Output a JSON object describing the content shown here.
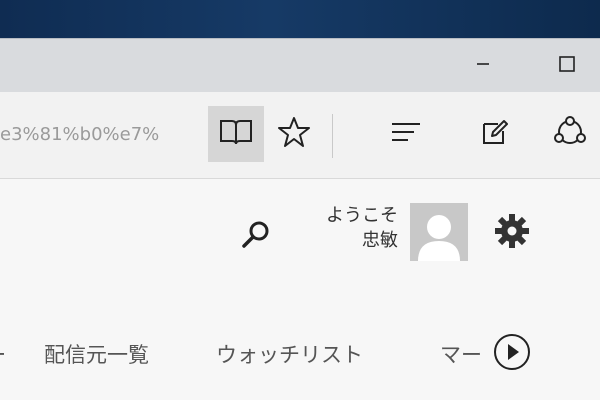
{
  "window": {
    "minimize_icon": "minimize-icon",
    "maximize_icon": "maximize-icon"
  },
  "toolbar": {
    "url_text": "e3%81%b0%e7%",
    "icons": [
      "reading-view-icon",
      "favorite-star-icon",
      "hub-icon",
      "web-note-icon",
      "share-icon"
    ]
  },
  "header": {
    "welcome_line1": "ようこそ",
    "welcome_line2": "忠敏",
    "icons": [
      "search-icon",
      "avatar",
      "settings-gear-icon"
    ]
  },
  "nav": {
    "partial_left": "ー",
    "items": [
      "配信元一覧",
      "ウォッチリスト",
      "マー"
    ],
    "next_icon": "next-arrow-icon"
  },
  "colors": {
    "desktop": "#163a66",
    "titlebar": "#d9dbde",
    "toolbar": "#f2f2f2",
    "content": "#f7f7f7",
    "icon": "#222222",
    "gray_text": "#9a9a9a"
  }
}
